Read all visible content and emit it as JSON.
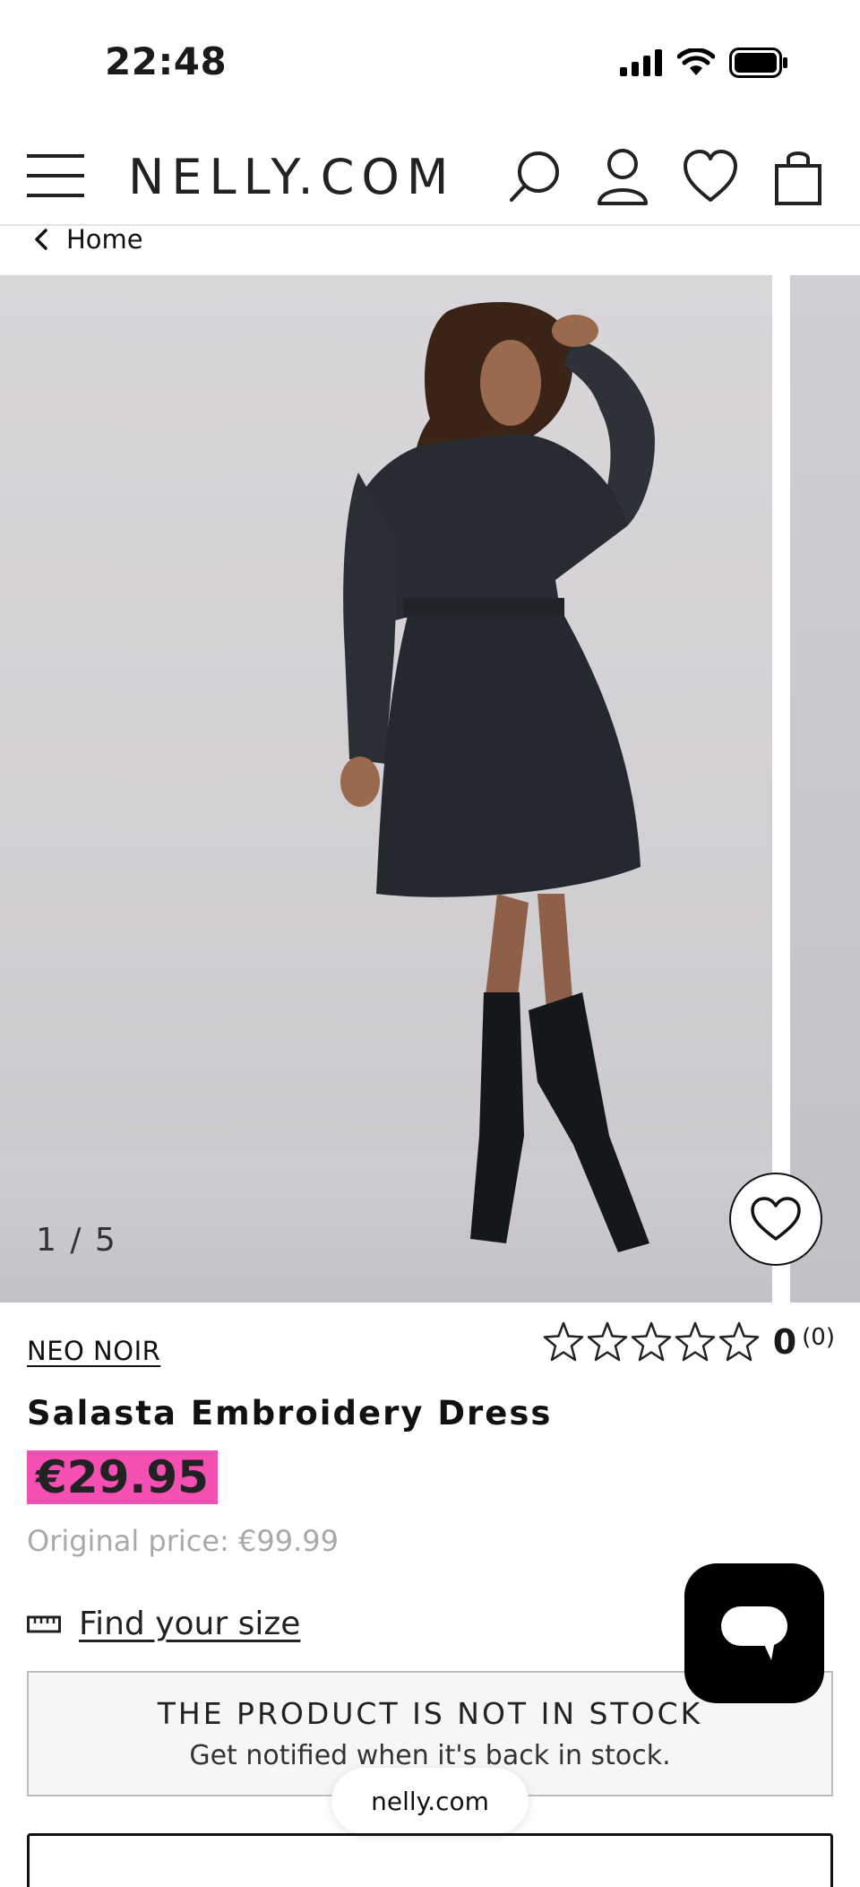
{
  "status_bar": {
    "time": "22:48"
  },
  "header": {
    "logo": "NELLY.COM"
  },
  "breadcrumb": {
    "label": "Home"
  },
  "gallery": {
    "counter": "1 / 5"
  },
  "product": {
    "brand": "NEO NOIR",
    "title": "Salasta Embroidery Dress",
    "price": "€29.95",
    "original_price": "Original price: €99.99",
    "rating": {
      "value": "0",
      "count": "(0)",
      "stars_filled": 0,
      "stars_total": 5
    },
    "find_size": "Find your size"
  },
  "stock": {
    "title": "THE PRODUCT IS NOT IN STOCK",
    "subtitle": "Get notified when it's back in stock."
  },
  "browser": {
    "url": "nelly.com"
  },
  "colors": {
    "price_highlight": "#f54fb4",
    "accent": "#000000"
  }
}
